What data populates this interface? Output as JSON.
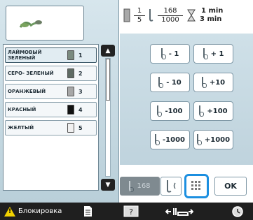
{
  "header": {
    "fraction1": {
      "num": "1",
      "den": "5"
    },
    "fraction2": {
      "num": "168",
      "den": "1000"
    },
    "time": {
      "num": "1 min",
      "den": "3 min"
    }
  },
  "thread_list": {
    "rows": [
      {
        "name": "ЛАЙМОВЫЙ ЗЕЛЕНЫЙ",
        "number": "1",
        "color": "#7a8a7f",
        "selected": true
      },
      {
        "name": "СЕРО- ЗЕЛЕНЫЙ",
        "number": "2",
        "color": "#5f6b63"
      },
      {
        "name": "ОРАНЖЕВЫЙ",
        "number": "3",
        "color": "#a7a7a7"
      },
      {
        "name": "КРАСНЫЙ",
        "number": "4",
        "color": "#111111"
      },
      {
        "name": "ЖЕЛТЫЙ",
        "number": "5",
        "color": "#f0f0f0"
      }
    ],
    "scroll_up": "▲",
    "scroll_down": "▼"
  },
  "adjust_buttons": [
    {
      "label": "- 1"
    },
    {
      "label": "+ 1"
    },
    {
      "label": "- 10"
    },
    {
      "label": "+10"
    },
    {
      "label": "-100"
    },
    {
      "label": "+100"
    },
    {
      "label": "-1000"
    },
    {
      "label": "+1000"
    }
  ],
  "controls": {
    "count_value": "168",
    "ok_label": "OK"
  },
  "bottom_bar": {
    "lock_label": "Блокировка"
  },
  "colors": {
    "accent": "#1c8fe0",
    "warning": "#f2d200",
    "panel": "#c8dbe4"
  }
}
